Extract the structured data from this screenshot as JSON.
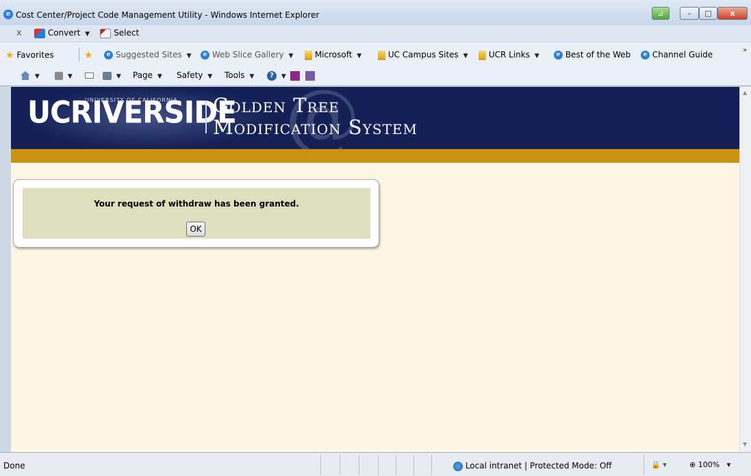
{
  "window": {
    "title": "Cost Center/Project Code Management Utility - Windows Internet Explorer",
    "minimize_glyph": "–",
    "maximize_glyph": "□",
    "close_glyph": "x",
    "compat_glyph": "⊿"
  },
  "addon_bar": {
    "stop_glyph": "x",
    "convert_label": "Convert",
    "select_label": "Select",
    "dropdown_glyph": "▼"
  },
  "favorites_bar": {
    "favorites_label": "Favorites",
    "items": [
      {
        "label": "Suggested Sites"
      },
      {
        "label": "Web Slice Gallery"
      },
      {
        "label": "Microsoft"
      },
      {
        "label": "UC Campus Sites"
      },
      {
        "label": "UCR Links"
      },
      {
        "label": "Best of the Web"
      },
      {
        "label": "Channel Guide"
      }
    ],
    "overflow_glyph": "»"
  },
  "command_bar": {
    "page_label": "Page",
    "safety_label": "Safety",
    "tools_label": "Tools",
    "help_glyph": "?"
  },
  "banner": {
    "logo_text": "UCRIVERSIDE",
    "logo_subtext": "UNIVERSITY OF CALIFORNIA",
    "title_line1": "Golden Tree",
    "title_line2": "Modification System"
  },
  "dialog": {
    "message": "Your request of withdraw has been granted.",
    "ok_label": "OK"
  },
  "status_bar": {
    "status": "Done",
    "zone": "Local intranet | Protected Mode: Off",
    "zoom": "100%"
  },
  "colors": {
    "banner": "#142056",
    "gold_band": "#c89212",
    "page_bg": "#fef5e7",
    "dialog_fill": "#dddfbe"
  }
}
